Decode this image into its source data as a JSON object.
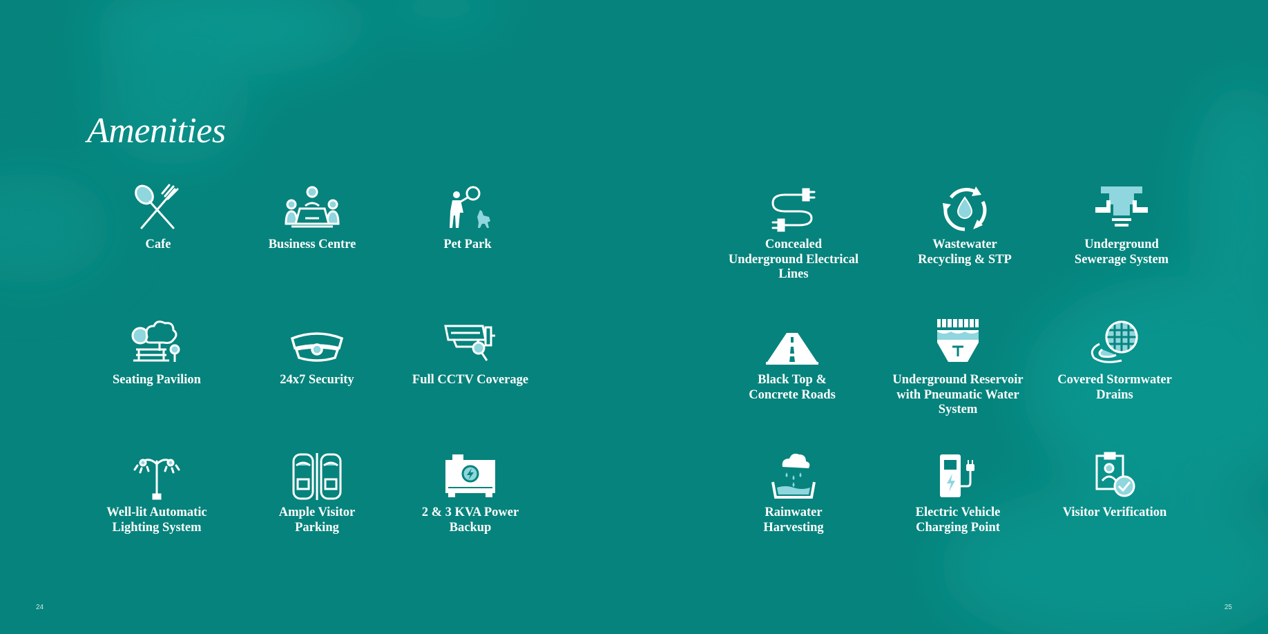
{
  "title": "Amenities",
  "colors": {
    "background": "#06837c",
    "icon_light": "#8fd6de",
    "text": "#ffffff"
  },
  "pages": {
    "left": "24",
    "right": "25"
  },
  "amenities": [
    {
      "label": "Cafe",
      "icon": "spoon-fork-icon"
    },
    {
      "label": "Business Centre",
      "icon": "meeting-table-icon"
    },
    {
      "label": "Pet Park",
      "icon": "person-with-dog-icon"
    },
    {
      "label": "Seating Pavilion",
      "icon": "bench-tree-icon"
    },
    {
      "label": "24x7 Security",
      "icon": "security-cap-icon"
    },
    {
      "label": "Full CCTV Coverage",
      "icon": "cctv-camera-icon"
    },
    {
      "label": "Well-lit Automatic\nLighting System",
      "icon": "street-lamp-icon"
    },
    {
      "label": "Ample Visitor\nParking",
      "icon": "parked-cars-icon"
    },
    {
      "label": "2 & 3 KVA Power\nBackup",
      "icon": "generator-icon"
    },
    {
      "label": "Concealed\nUnderground Electrical\nLines",
      "icon": "cable-plug-icon"
    },
    {
      "label": "Wastewater\nRecycling & STP",
      "icon": "water-recycle-icon"
    },
    {
      "label": "Underground\nSewerage System",
      "icon": "sewer-pipe-icon"
    },
    {
      "label": "Black Top &\nConcrete Roads",
      "icon": "road-icon"
    },
    {
      "label": "Underground Reservoir\nwith Pneumatic Water\nSystem",
      "icon": "reservoir-tank-icon"
    },
    {
      "label": "Covered Stormwater\nDrains",
      "icon": "drain-cover-icon"
    },
    {
      "label": "Rainwater\nHarvesting",
      "icon": "rain-collection-icon"
    },
    {
      "label": "Electric Vehicle\nCharging Point",
      "icon": "ev-charger-icon"
    },
    {
      "label": "Visitor Verification",
      "icon": "id-check-icon"
    }
  ]
}
